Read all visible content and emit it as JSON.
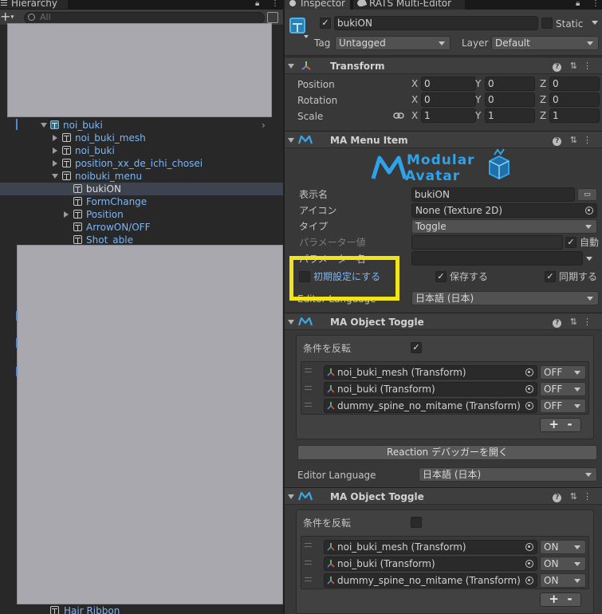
{
  "hierarchy": {
    "tab_label": "Hierarchy",
    "search_placeholder": "All",
    "rows": [
      {
        "label": "noi_buki"
      },
      {
        "label": "noi_buki_mesh"
      },
      {
        "label": "noi_buki"
      },
      {
        "label": "position_xx_de_ichi_chosei"
      },
      {
        "label": "noibuki_menu"
      },
      {
        "label": "bukiON"
      },
      {
        "label": "FormChange"
      },
      {
        "label": "Position"
      },
      {
        "label": "ArrowON/OFF"
      },
      {
        "label": "Shot_able"
      },
      {
        "label": "Hair Ribbon"
      }
    ]
  },
  "inspector": {
    "tabs": {
      "inspector": "Inspector",
      "rats": "RATS Multi-Editor"
    },
    "object": {
      "name": "bukiON",
      "active": true,
      "static_label": "Static",
      "tag_label": "Tag",
      "tag_value": "Untagged",
      "layer_label": "Layer",
      "layer_value": "Default"
    },
    "transform": {
      "title": "Transform",
      "position_label": "Position",
      "rotation_label": "Rotation",
      "scale_label": "Scale",
      "axis_x": "X",
      "axis_y": "Y",
      "axis_z": "Z",
      "position": [
        "0",
        "0",
        "0"
      ],
      "rotation": [
        "0",
        "0",
        "0"
      ],
      "scale": [
        "1",
        "1",
        "1"
      ]
    },
    "menu_item": {
      "title": "MA Menu Item",
      "logo_top": "Modular",
      "logo_bottom": "Avatar",
      "display_name_label": "表示名",
      "display_name_value": "bukiON",
      "icon_label": "アイコン",
      "icon_value": "None (Texture 2D)",
      "type_label": "タイプ",
      "type_value": "Toggle",
      "param_value_label": "パラメーター値",
      "auto_label": "自動",
      "param_name_label": "パラメーター名",
      "default_label": "初期設定にする",
      "saved_label": "保存する",
      "synced_label": "同期する",
      "editor_language_label": "Editor Language",
      "editor_language_value": "日本語 (日本)"
    },
    "toggle1": {
      "title": "MA Object Toggle",
      "invert_label": "条件を反転",
      "items": [
        {
          "object": "noi_buki_mesh (Transform)",
          "state": "OFF"
        },
        {
          "object": "noi_buki (Transform)",
          "state": "OFF"
        },
        {
          "object": "dummy_spine_no_mitame (Transform)",
          "state": "OFF"
        }
      ],
      "plus": "+",
      "minus": "-",
      "debugger_button": "Reaction デバッガーを開く",
      "editor_language_label": "Editor Language",
      "editor_language_value": "日本語 (日本)"
    },
    "toggle2": {
      "title": "MA Object Toggle",
      "invert_label": "条件を反転",
      "items": [
        {
          "object": "noi_buki_mesh (Transform)",
          "state": "ON"
        },
        {
          "object": "noi_buki (Transform)",
          "state": "ON"
        },
        {
          "object": "dummy_spine_no_mitame (Transform)",
          "state": "ON"
        }
      ],
      "plus": "+",
      "minus": "-"
    }
  },
  "colors": {
    "highlight": "#f2e41a",
    "hierarchy_text": "#7fb5f0",
    "accent_blue": "#4fb3ea"
  }
}
